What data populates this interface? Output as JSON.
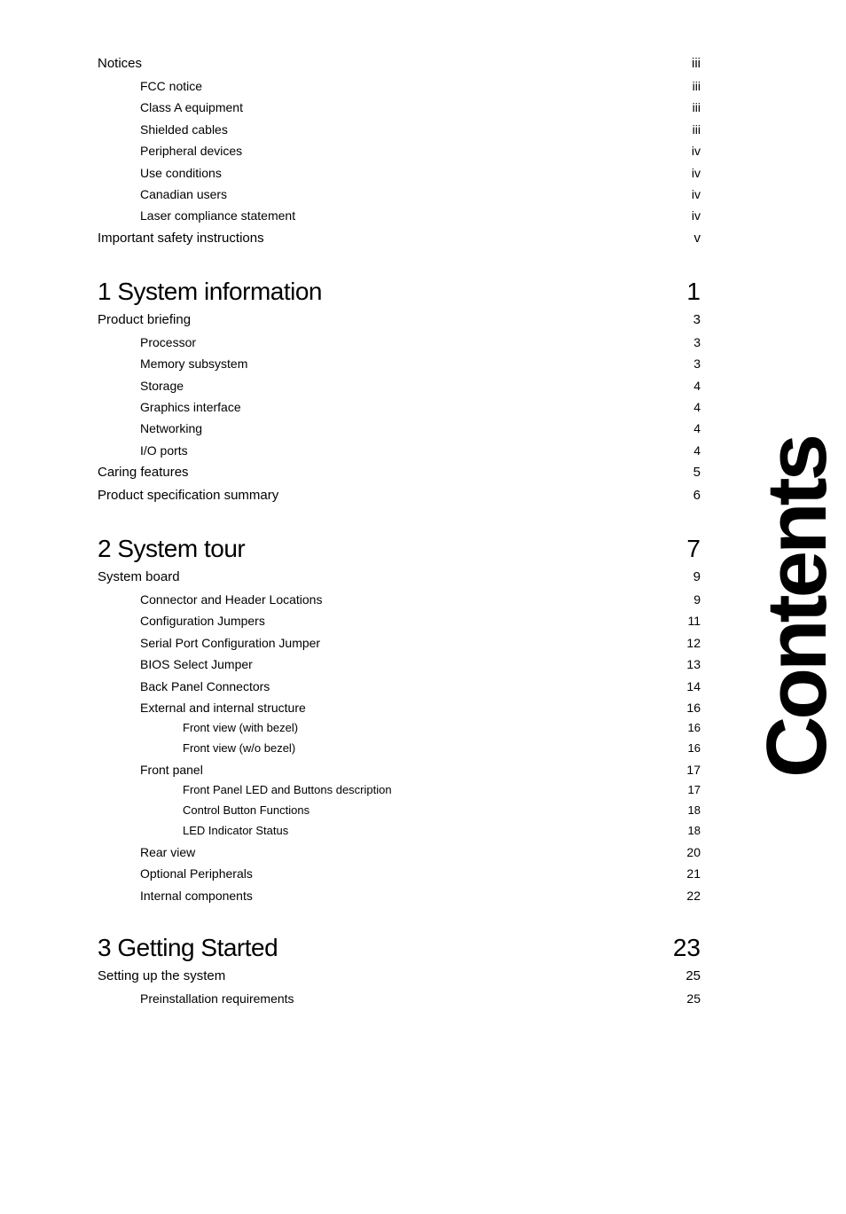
{
  "sidebar": {
    "label": "Contents"
  },
  "toc": {
    "sections": [
      {
        "type": "section",
        "items": [
          {
            "level": 0,
            "label": "Notices",
            "page": "iii"
          },
          {
            "level": 1,
            "label": "FCC notice",
            "page": "iii"
          },
          {
            "level": 1,
            "label": "Class A equipment",
            "page": "iii"
          },
          {
            "level": 1,
            "label": "Shielded cables",
            "page": "iii"
          },
          {
            "level": 1,
            "label": "Peripheral devices",
            "page": "iv"
          },
          {
            "level": 1,
            "label": "Use conditions",
            "page": "iv"
          },
          {
            "level": 1,
            "label": "Canadian users",
            "page": "iv"
          },
          {
            "level": 1,
            "label": "Laser compliance statement",
            "page": "iv"
          },
          {
            "level": 0,
            "label": "Important safety instructions",
            "page": "v"
          }
        ]
      },
      {
        "type": "chapter",
        "number": "1",
        "title": "System information",
        "page": "1",
        "items": [
          {
            "level": 0,
            "label": "Product briefing",
            "page": "3"
          },
          {
            "level": 1,
            "label": "Processor",
            "page": "3"
          },
          {
            "level": 1,
            "label": "Memory subsystem",
            "page": "3"
          },
          {
            "level": 1,
            "label": "Storage",
            "page": "4"
          },
          {
            "level": 1,
            "label": "Graphics interface",
            "page": "4"
          },
          {
            "level": 1,
            "label": "Networking",
            "page": "4"
          },
          {
            "level": 1,
            "label": "I/O ports",
            "page": "4"
          },
          {
            "level": 0,
            "label": "Caring features",
            "page": "5"
          },
          {
            "level": 0,
            "label": "Product specification summary",
            "page": "6"
          }
        ]
      },
      {
        "type": "chapter",
        "number": "2",
        "title": "System tour",
        "page": "7",
        "items": [
          {
            "level": 0,
            "label": "System board",
            "page": "9"
          },
          {
            "level": 1,
            "label": "Connector and Header Locations",
            "page": "9"
          },
          {
            "level": 1,
            "label": "Configuration Jumpers",
            "page": "11"
          },
          {
            "level": 1,
            "label": "Serial Port Configuration Jumper",
            "page": "12"
          },
          {
            "level": 1,
            "label": "BIOS Select Jumper",
            "page": "13"
          },
          {
            "level": 1,
            "label": "Back Panel Connectors",
            "page": "14"
          },
          {
            "level": 1,
            "label": "External and internal structure",
            "page": "16"
          },
          {
            "level": 2,
            "label": "Front view (with bezel)",
            "page": "16"
          },
          {
            "level": 2,
            "label": "Front view (w/o bezel)",
            "page": "16"
          },
          {
            "level": 1,
            "label": "Front panel",
            "page": "17"
          },
          {
            "level": 2,
            "label": "Front Panel LED and Buttons description",
            "page": "17"
          },
          {
            "level": 2,
            "label": "Control Button Functions",
            "page": "18"
          },
          {
            "level": 2,
            "label": "LED Indicator Status",
            "page": "18"
          },
          {
            "level": 1,
            "label": "Rear view",
            "page": "20"
          },
          {
            "level": 1,
            "label": "Optional Peripherals",
            "page": "21"
          },
          {
            "level": 1,
            "label": "Internal components",
            "page": "22"
          }
        ]
      },
      {
        "type": "chapter",
        "number": "3",
        "title": "Getting Started",
        "page": "23",
        "items": [
          {
            "level": 0,
            "label": "Setting up the system",
            "page": "25"
          },
          {
            "level": 1,
            "label": "Preinstallation requirements",
            "page": "25"
          }
        ]
      }
    ]
  }
}
